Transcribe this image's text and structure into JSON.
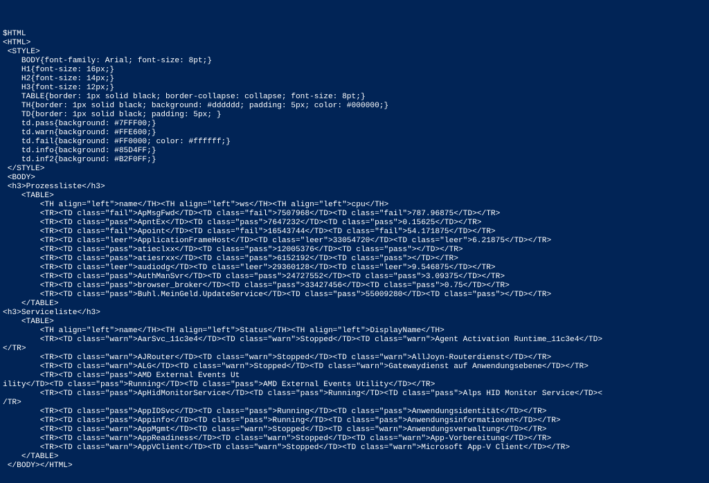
{
  "colors": {
    "background": "#012456",
    "text": "#ffffff",
    "pass": "#7FFF00",
    "warn": "#FFE600",
    "fail": "#FF0000",
    "info": "#85D4FF",
    "inf2": "#B2F0FF",
    "th_bg": "#dddddd",
    "th_fg": "#000000"
  },
  "header_var": "$HTML",
  "style_lines": [
    "BODY{font-family: Arial; font-size: 8pt;}",
    "H1{font-size: 16px;}",
    "H2{font-size: 14px;}",
    "H3{font-size: 12px;}",
    "TABLE{border: 1px solid black; border-collapse: collapse; font-size: 8pt;}",
    "TH{border: 1px solid black; background: #dddddd; padding: 5px; color: #000000;}",
    "TD{border: 1px solid black; padding: 5px; }",
    "td.pass{background: #7FFF00;}",
    "td.warn{background: #FFE600;}",
    "td.fail{background: #FF0000; color: #ffffff;}",
    "td.info{background: #85D4FF;}",
    "td.inf2{background: #B2F0FF;}"
  ],
  "section1": {
    "title": "Prozessliste",
    "headers": [
      "name",
      "ws",
      "cpu"
    ],
    "rows": [
      {
        "cls": "fail",
        "c": [
          "ApMsgFwd",
          "7507968",
          "787.96875"
        ]
      },
      {
        "cls": "pass",
        "c": [
          "ApntEx",
          "7647232",
          "0.15625"
        ]
      },
      {
        "cls": "fail",
        "c": [
          "Apoint",
          "16543744",
          "54.171875"
        ]
      },
      {
        "cls": "leer",
        "c": [
          "ApplicationFrameHost",
          "33054720",
          "6.21875"
        ]
      },
      {
        "cls": "pass",
        "c": [
          "atieclxx",
          "12005376",
          ""
        ]
      },
      {
        "cls": "pass",
        "c": [
          "atiesrxx",
          "6152192",
          ""
        ]
      },
      {
        "cls": "leer",
        "c": [
          "audiodg",
          "29360128",
          "9.546875"
        ]
      },
      {
        "cls": "pass",
        "c": [
          "AuthManSvr",
          "24727552",
          "3.09375"
        ]
      },
      {
        "cls": "pass",
        "c": [
          "browser_broker",
          "33427456",
          "0.75"
        ]
      },
      {
        "cls": "pass",
        "c": [
          "Buhl.MeinGeld.UpdateService",
          "55009280",
          ""
        ]
      }
    ]
  },
  "section2": {
    "title": "Serviceliste",
    "headers": [
      "name",
      "Status",
      "DisplayName"
    ],
    "rows": [
      {
        "cls": "warn",
        "c": [
          "AarSvc_11c3e4",
          "Stopped",
          "Agent Activation Runtime_11c3e4"
        ],
        "wrap": true
      },
      {
        "cls": "warn",
        "c": [
          "AJRouter",
          "Stopped",
          "AllJoyn-Routerdienst"
        ]
      },
      {
        "cls": "warn",
        "c": [
          "ALG",
          "Stopped",
          "Gatewaydienst auf Anwendungsebene"
        ]
      },
      {
        "cls": "pass",
        "c": [
          "AMD External Events Utility",
          "Running",
          "AMD External Events Utility"
        ],
        "wrap": true,
        "wraplabel": "ility"
      },
      {
        "cls": "pass",
        "c": [
          "ApHidMonitorService",
          "Running",
          "Alps HID Monitor Service"
        ],
        "wrap": true,
        "wraplabel": "/TR>"
      },
      {
        "cls": "pass",
        "c": [
          "AppIDSvc",
          "Running",
          "Anwendungsidentität"
        ]
      },
      {
        "cls": "pass",
        "c": [
          "Appinfo",
          "Running",
          "Anwendungsinformationen"
        ]
      },
      {
        "cls": "warn",
        "c": [
          "AppMgmt",
          "Stopped",
          "Anwendungsverwaltung"
        ]
      },
      {
        "cls": "warn",
        "c": [
          "AppReadiness",
          "Stopped",
          "App-Vorbereitung"
        ]
      },
      {
        "cls": "warn",
        "c": [
          "AppVClient",
          "Stopped",
          "Microsoft App-V Client"
        ]
      }
    ]
  },
  "tags": {
    "html_open": "<HTML>",
    "html_close": "</HTML>",
    "style_open": "<STYLE>",
    "style_close": "</STYLE>",
    "body_open": "<BODY>",
    "body_close": "</BODY>",
    "table_open": "<TABLE>",
    "table_close": "</TABLE>",
    "tr_open": "<TR>",
    "tr_close": "</TR>",
    "td_close": "</TD>",
    "th_close": "</TH>",
    "h3_close": "</h3>"
  },
  "indent": {
    "one": "  ",
    "two": "    ",
    "three": "        "
  }
}
